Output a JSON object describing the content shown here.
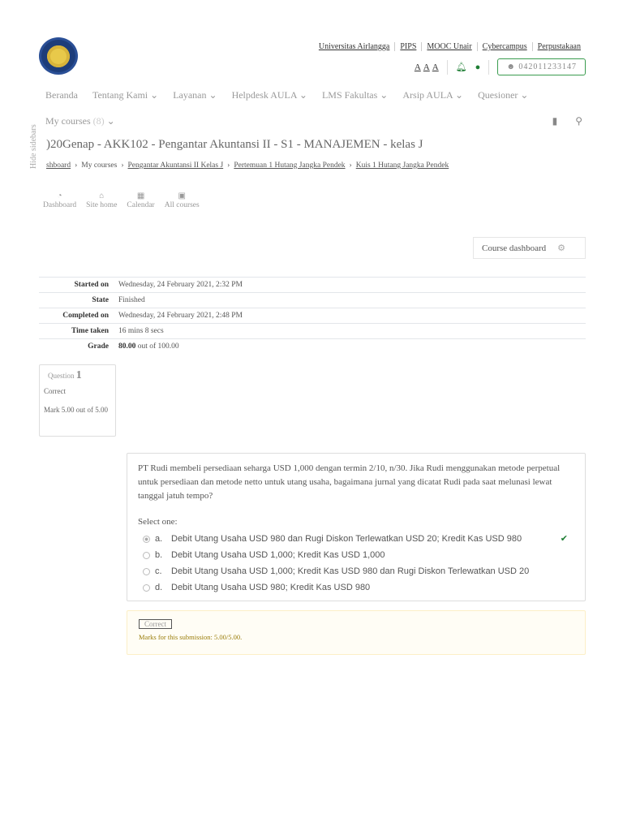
{
  "header": {
    "top_links": [
      "Universitas Airlangga",
      "PIPS",
      "MOOC Unair",
      "Cybercampus",
      "Perpustakaan"
    ],
    "font_size_controls": [
      "A",
      "A",
      "A"
    ],
    "user_id": "042011233147"
  },
  "nav": {
    "items": [
      "Beranda",
      "Tentang Kami",
      "Layanan",
      "Helpdesk AULA",
      "LMS Fakultas",
      "Arsip AULA",
      "Quesioner"
    ],
    "my_courses": "My courses",
    "my_courses_count": "(8)"
  },
  "page": {
    "title": ")20Genap - AKK102 - Pengantar Akuntansi II - S1 - MANAJEMEN - kelas J",
    "hide_sidebars": "Hide sidebars",
    "breadcrumb": [
      "shboard",
      "My courses",
      "Pengantar Akuntansi II Kelas J",
      "Pertemuan 1 Hutang Jangka Pendek",
      "Kuis 1 Hutang Jangka Pendek"
    ],
    "quick_links": [
      "Dashboard",
      "Site home",
      "Calendar",
      "All courses"
    ],
    "course_dashboard": "Course dashboard"
  },
  "summary": [
    {
      "label": "Started on",
      "value": "Wednesday, 24 February 2021, 2:32 PM"
    },
    {
      "label": "State",
      "value": "Finished"
    },
    {
      "label": "Completed on",
      "value": "Wednesday, 24 February 2021, 2:48 PM"
    },
    {
      "label": "Time taken",
      "value": "16 mins 8 secs"
    },
    {
      "label": "Grade",
      "value_bold": "80.00",
      "value": "out of 100.00"
    }
  ],
  "question": {
    "label": "Question",
    "number": "1",
    "status": "Correct",
    "mark": "Mark 5.00 out of 5.00",
    "text": "PT Rudi membeli persediaan seharga USD 1,000 dengan termin 2/10, n/30. Jika Rudi menggunakan metode perpetual untuk persediaan dan metode netto untuk utang usaha, bagaimana jurnal yang dicatat Rudi pada saat melunasi lewat tanggal jatuh tempo?",
    "prompt": "Select one:",
    "options": [
      {
        "letter": "a.",
        "text": "Debit Utang Usaha USD 980 dan Rugi Diskon Terlewatkan USD 20; Kredit Kas USD 980",
        "selected": true,
        "correct": true
      },
      {
        "letter": "b.",
        "text": "Debit Utang Usaha USD 1,000; Kredit Kas USD 1,000"
      },
      {
        "letter": "c.",
        "text": "Debit Utang Usaha USD 1,000; Kredit Kas USD 980 dan Rugi Diskon Terlewatkan USD 20"
      },
      {
        "letter": "d.",
        "text": "Debit Utang Usaha USD 980; Kredit Kas USD 980"
      }
    ],
    "feedback_badge": "Correct",
    "feedback_marks": "Marks for this submission: 5.00/5.00."
  },
  "colors": {
    "accent_green": "#1e7e34",
    "marks": "#9a7d0a"
  }
}
